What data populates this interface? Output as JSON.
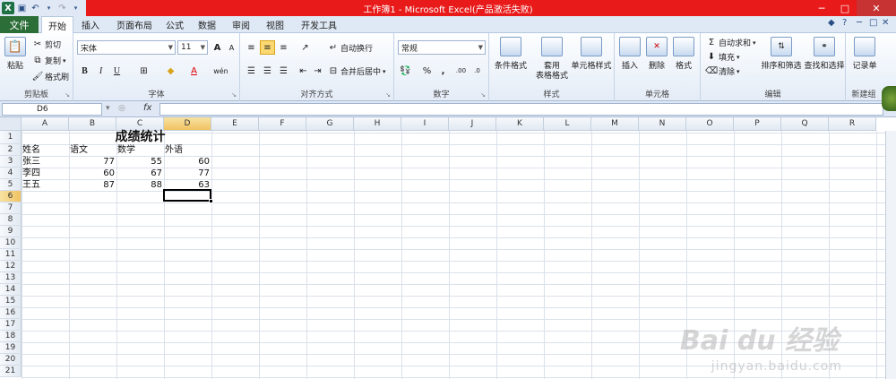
{
  "title_bar": {
    "title": "工作簿1 - Microsoft Excel(产品激活失败)",
    "qat": [
      "excel-logo",
      "save-icon",
      "undo-icon",
      "redo-icon",
      "customize-icon"
    ],
    "controls": [
      "─",
      "□",
      "✕"
    ]
  },
  "tabs": {
    "file": "文件",
    "items": [
      "开始",
      "插入",
      "页面布局",
      "公式",
      "数据",
      "审阅",
      "视图",
      "开发工具"
    ],
    "active": "开始",
    "right_icons": [
      "◆",
      "?",
      "─",
      "□",
      "✕"
    ]
  },
  "ribbon": {
    "clipboard": {
      "label": "剪贴板",
      "paste": "粘贴",
      "cut": "剪切",
      "copy": "复制",
      "format_painter": "格式刷"
    },
    "font": {
      "label": "字体",
      "font_name": "宋体",
      "font_size": "11",
      "bold": "B",
      "italic": "I",
      "underline": "U",
      "grow": "A",
      "shrink": "A",
      "wen": "wén"
    },
    "alignment": {
      "label": "对齐方式",
      "wrap": "自动换行",
      "merge": "合并后居中"
    },
    "number": {
      "label": "数字",
      "format": "常规",
      "percent": "%",
      "comma": ","
    },
    "styles": {
      "label": "样式",
      "conditional": "条件格式",
      "table1": "套用",
      "table2": "表格格式",
      "cell_style": "单元格样式"
    },
    "cells": {
      "label": "单元格",
      "insert": "插入",
      "delete": "删除",
      "format": "格式"
    },
    "editing": {
      "label": "编辑",
      "autosum": "自动求和",
      "fill": "填充",
      "clear": "清除",
      "sort": "排序和筛选",
      "find": "查找和选择"
    },
    "new_group": {
      "label": "新建组",
      "record": "记录单"
    }
  },
  "formula_bar": {
    "name_box": "D6",
    "fx": "fx",
    "content": ""
  },
  "columns": [
    "A",
    "B",
    "C",
    "D",
    "E",
    "F",
    "G",
    "H",
    "I",
    "J",
    "K",
    "L",
    "M",
    "N",
    "O",
    "P",
    "Q",
    "R"
  ],
  "selected_column": "D",
  "rows": [
    "1",
    "2",
    "3",
    "4",
    "5",
    "6",
    "7",
    "8",
    "9",
    "10",
    "11",
    "12",
    "13",
    "14",
    "15",
    "16",
    "17",
    "18",
    "19",
    "20",
    "21"
  ],
  "selected_row": "6",
  "sheet": {
    "title": "成绩统计",
    "headers": [
      "姓名",
      "语文",
      "数学",
      "外语"
    ],
    "records": [
      [
        "张三",
        "77",
        "55",
        "60"
      ],
      [
        "李四",
        "60",
        "67",
        "77"
      ],
      [
        "王五",
        "87",
        "88",
        "63"
      ]
    ]
  },
  "watermark": {
    "main": "Bai du 经验",
    "sub": "jingyan.baidu.com"
  }
}
